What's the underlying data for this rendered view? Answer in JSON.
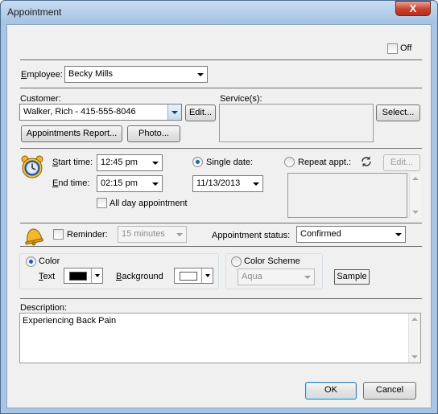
{
  "window": {
    "title": "Appointment",
    "close_glyph": "X"
  },
  "off_checkbox": {
    "label": "Off",
    "checked": false
  },
  "employee": {
    "label": "Employee:",
    "value": "Becky  Mills"
  },
  "customer": {
    "label": "Customer:",
    "value": "Walker, Rich - 415-555-8046",
    "edit_label": "Edit...",
    "appointments_report_label": "Appointments Report...",
    "photo_label": "Photo..."
  },
  "services": {
    "label": "Service(s):",
    "select_label": "Select..."
  },
  "time": {
    "start_label": "Start time:",
    "start_value": "12:45 pm",
    "end_label": "End time:",
    "end_value": "02:15 pm",
    "all_day_label": "All day appointment",
    "all_day_checked": false,
    "single_date_label": "Single date:",
    "single_date_value": "11/13/2013",
    "single_selected": true,
    "repeat_label": "Repeat appt.:",
    "repeat_edit_label": "Edit..."
  },
  "reminder": {
    "label": "Reminder:",
    "checked": false,
    "value": "15 minutes"
  },
  "status": {
    "label": "Appointment status:",
    "value": "Confirmed"
  },
  "colors": {
    "color_label": "Color",
    "color_selected": true,
    "text_label": "Text",
    "text_color": "#000000",
    "background_label": "Background",
    "background_color": "#ffffff",
    "scheme_label": "Color Scheme",
    "scheme_value": "Aqua",
    "sample_label": "Sample"
  },
  "description": {
    "label": "Description:",
    "value": "Experiencing Back Pain"
  },
  "footer": {
    "ok_label": "OK",
    "cancel_label": "Cancel"
  },
  "icons": {
    "clock": "alarm-clock-icon",
    "bell": "bell-icon",
    "repeat": "refresh-icon"
  }
}
